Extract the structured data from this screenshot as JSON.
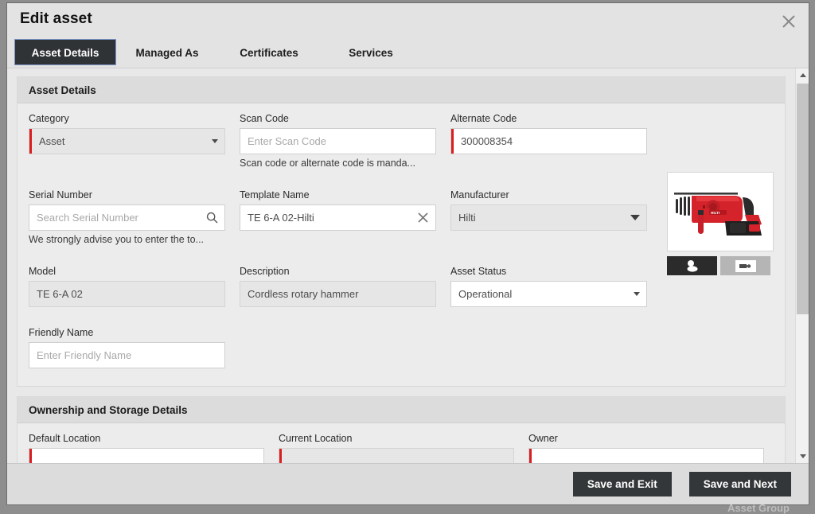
{
  "dialog": {
    "title": "Edit asset",
    "close_icon": "close-icon"
  },
  "tabs": [
    {
      "label": "Asset Details",
      "active": true
    },
    {
      "label": "Managed As",
      "active": false
    },
    {
      "label": "Certificates",
      "active": false
    },
    {
      "label": "Services",
      "active": false
    }
  ],
  "sections": {
    "asset_details": {
      "header": "Asset Details",
      "fields": {
        "category": {
          "label": "Category",
          "value": "Asset",
          "required": true,
          "disabled": true,
          "control": "select"
        },
        "scan_code": {
          "label": "Scan Code",
          "value": "",
          "placeholder": "Enter Scan Code",
          "required": false,
          "disabled": false,
          "control": "text",
          "helper": "Scan code or alternate code is manda..."
        },
        "alternate_code": {
          "label": "Alternate Code",
          "value": "300008354",
          "required": true,
          "disabled": false,
          "control": "text"
        },
        "serial_number": {
          "label": "Serial Number",
          "value": "",
          "placeholder": "Search Serial Number",
          "required": false,
          "disabled": false,
          "control": "search",
          "icon": "search-icon",
          "helper": "We strongly advise you to enter the to..."
        },
        "template_name": {
          "label": "Template Name",
          "value": "TE 6-A 02-Hilti",
          "required": false,
          "disabled": false,
          "control": "text",
          "icon": "clear-icon"
        },
        "manufacturer": {
          "label": "Manufacturer",
          "value": "Hilti",
          "required": false,
          "disabled": true,
          "control": "select"
        },
        "model": {
          "label": "Model",
          "value": "TE 6-A 02",
          "required": false,
          "disabled": true,
          "control": "text"
        },
        "description": {
          "label": "Description",
          "value": "Cordless rotary hammer",
          "required": false,
          "disabled": true,
          "control": "text"
        },
        "asset_status": {
          "label": "Asset Status",
          "value": "Operational",
          "required": false,
          "disabled": false,
          "control": "select"
        },
        "friendly_name": {
          "label": "Friendly Name",
          "value": "",
          "placeholder": "Enter Friendly Name",
          "required": false,
          "disabled": false,
          "control": "text"
        }
      },
      "asset_image": {
        "alt": "hilti-cordless-rotary-hammer",
        "thumbnails": [
          {
            "name": "photo-thumbnail",
            "selected": true
          },
          {
            "name": "drawing-thumbnail",
            "selected": false
          }
        ]
      }
    },
    "ownership_storage": {
      "header": "Ownership and Storage Details",
      "fields": {
        "default_location": {
          "label": "Default Location",
          "value": "",
          "required": true,
          "disabled": false
        },
        "current_location": {
          "label": "Current Location",
          "value": "",
          "required": true,
          "disabled": true
        },
        "owner": {
          "label": "Owner",
          "value": "",
          "required": true,
          "disabled": false
        }
      }
    }
  },
  "footer": {
    "save_and_exit": "Save and Exit",
    "save_and_next": "Save and Next"
  },
  "background": {
    "watermark": "Asset Group"
  },
  "colors": {
    "required_red": "#d81e20",
    "tab_active_bg": "#2f3336",
    "button_bg": "#333739",
    "panel_header_bg": "#dcdcdc"
  }
}
